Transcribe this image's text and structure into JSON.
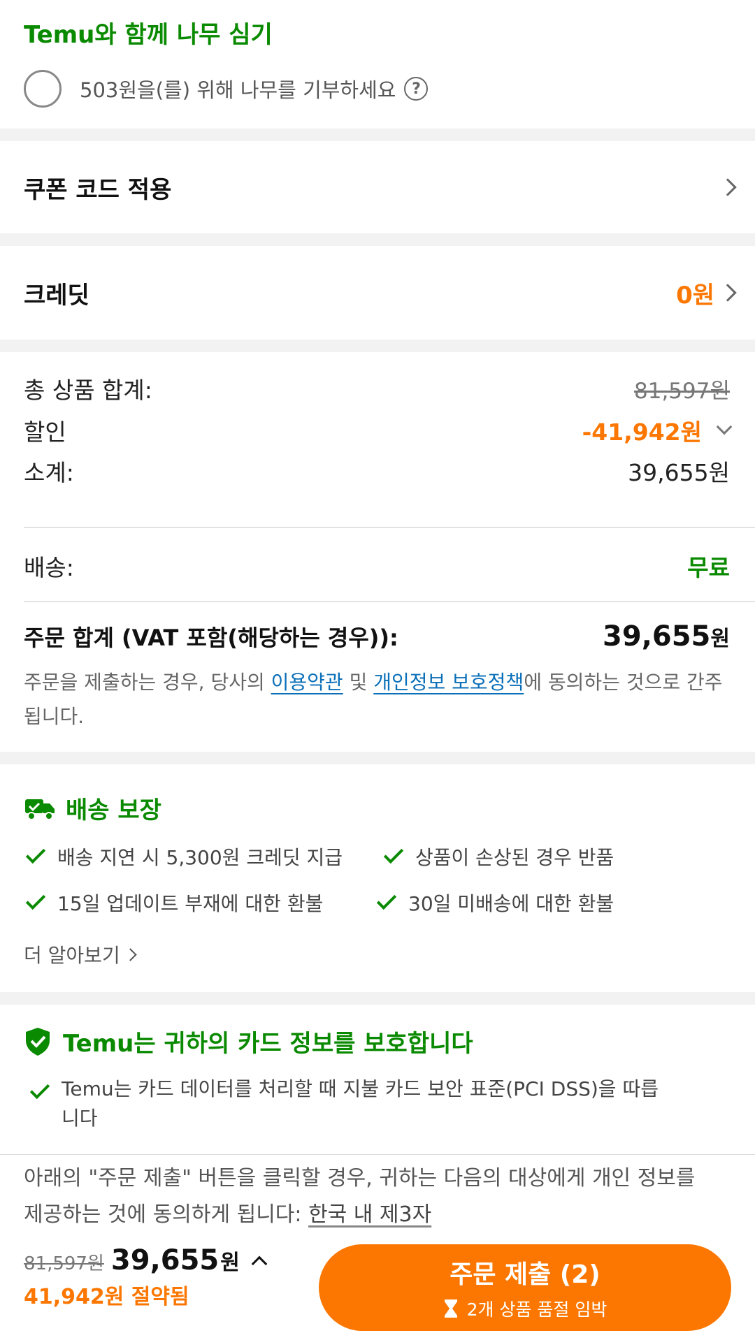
{
  "tree": {
    "title": "Temu와 함께 나무 심기",
    "donate_label": "503원을(를) 위해 나무를 기부하세요",
    "help_glyph": "?"
  },
  "coupon": {
    "label": "쿠폰 코드 적용"
  },
  "credit": {
    "label": "크레딧",
    "value": "0원"
  },
  "summary": {
    "items_total_label": "총 상품 합계:",
    "items_total_value": "81,597원",
    "discount_label": "할인",
    "discount_value": "-41,942원",
    "subtotal_label": "소계:",
    "subtotal_value": "39,655원",
    "shipping_label": "배송:",
    "shipping_value": "무료",
    "order_total_label": "주문 합계 (VAT 포함(해당하는 경우)):",
    "order_total_number": "39,655",
    "order_total_unit": "원",
    "agree_prefix": "주문을 제출하는 경우, 당사의 ",
    "terms_link": "이용약관",
    "agree_and": " 및 ",
    "privacy_link": "개인정보 보호정책",
    "agree_suffix": "에 동의하는 것으로 간주됩니다."
  },
  "delivery": {
    "title": "배송 보장",
    "features": [
      "배송 지연 시 5,300원 크레딧 지급",
      "상품이 손상된 경우 반품",
      "15일 업데이트 부재에 대한 환불",
      "30일 미배송에 대한 환불"
    ],
    "more": "더 알아보기"
  },
  "card": {
    "title": "Temu는 귀하의 카드 정보를 보호합니다",
    "text": "Temu는 카드 데이터를 처리할 때 지불 카드 보안 표준(PCI DSS)을 따릅니다"
  },
  "bottom": {
    "consent_text": "아래의 \"주문 제출\" 버튼을 클릭할 경우, 귀하는 다음의 대상에게 개인 정보를 제공하는 것에 동의하게 됩니다: ",
    "consent_link": "한국 내 제3자",
    "old_price": "81,597원",
    "price_number": "39,655",
    "price_unit": "원",
    "saved": "41,942원 절약됨",
    "submit_label": "주문 제출 (2)",
    "submit_sub": "2개 상품 품절 임박"
  },
  "colors": {
    "accent": "#fb7701",
    "green": "#0a8a00",
    "link": "#0a6fb8"
  }
}
